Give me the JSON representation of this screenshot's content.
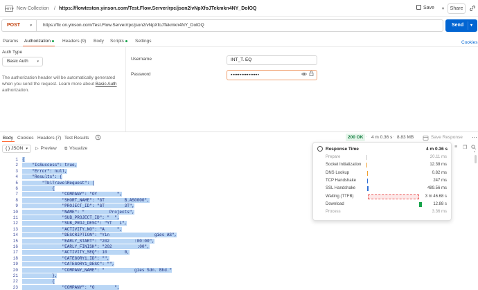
{
  "titlebar": {
    "http_badge": "HTTP",
    "collection": "New Collection",
    "separator": "/",
    "request_url": "https://flowteston.yinson.com/Test.Flow.Server/rpc/json2/vNpXfoJTekmkn4NY_DolOQ",
    "save_label": "Save",
    "save_chevron": "▾",
    "share_label": "Share",
    "link_icon": "link-icon"
  },
  "urlbar": {
    "method": "POST",
    "url": "https://flc                on.yinson.com/Test.Flow.Server/rpc/json2/vNpXfoJTekmkn4NY_DolOQ",
    "send_label": "Send",
    "send_chevron": "▾"
  },
  "request_tabs": {
    "params": "Params",
    "authorization": "Authorization",
    "headers": "Headers (9)",
    "body": "Body",
    "scripts": "Scripts",
    "settings": "Settings",
    "active": "authorization",
    "cookies": "Cookies"
  },
  "auth": {
    "type_label": "Auth Type",
    "type_value": "Basic Auth",
    "type_chevron": "▾",
    "description_text": "The authorization header will be automatically generated when you send the request. Learn more about ",
    "description_link": "Basic Auth",
    "description_end": " authorization.",
    "username_label": "Username",
    "username_value": "INT_T.       EQ",
    "password_label": "Password",
    "password_value": "••••••••••••••••",
    "eye_icon": "eye-icon",
    "lock_icon": "lock-icon"
  },
  "response_tabs": {
    "body": "Body",
    "cookies": "Cookies",
    "headers": "Headers (7)",
    "test_results": "Test Results",
    "history_icon": "history-icon",
    "status": "200 OK",
    "time": "4 m 0.36 s",
    "size": "8.83 MB",
    "save_response": "Save Response",
    "more_icon": "more-icon"
  },
  "body_toolbar": {
    "format": "{ } JSON",
    "format_chevron": "▾",
    "preview": "Preview",
    "visualize": "Visualize",
    "filter_icon": "filter-icon",
    "copy_icon": "copy-icon",
    "search_icon": "search-icon"
  },
  "code_lines": [
    {
      "n": "1",
      "indent": "",
      "text": "{"
    },
    {
      "n": "2",
      "indent": "    ",
      "text": "\"IsSuccess\": true,"
    },
    {
      "n": "3",
      "indent": "    ",
      "text": "\"Error\": null,"
    },
    {
      "n": "4",
      "indent": "    ",
      "text": "\"Results\": {"
    },
    {
      "n": "5",
      "indent": "        ",
      "text": "\"TblTravelRequest\": ["
    },
    {
      "n": "6",
      "indent": "            ",
      "text": "{"
    },
    {
      "n": "7",
      "indent": "                ",
      "text": "\"COMPANY\": \"OY        \","
    },
    {
      "n": "8",
      "indent": "                ",
      "text": "\"SHORT_NAME\": \"GT        B.AS0000\","
    },
    {
      "n": "9",
      "indent": "                ",
      "text": "\"PROJECT_ID\": \"GT        3T\","
    },
    {
      "n": "10",
      "indent": "                ",
      "text": "\"NAME\": \"          Projects\","
    },
    {
      "n": "11",
      "indent": "                ",
      "text": "\"SUB_PROJECT_ID\": \"  \","
    },
    {
      "n": "12",
      "indent": "                ",
      "text": "\"SUB_PROJ_DESC\": \"YT   L\","
    },
    {
      "n": "13",
      "indent": "                ",
      "text": "\"ACTIVITY_NO\": \"A     \","
    },
    {
      "n": "14",
      "indent": "                ",
      "text": "\"DESCRIPTION\": \"Yin                  gies AS\","
    },
    {
      "n": "15",
      "indent": "                ",
      "text": "\"EARLY_START\": \"202          :00:00\","
    },
    {
      "n": "16",
      "indent": "                ",
      "text": "\"EARLY_FINISH\": \"202          :00\","
    },
    {
      "n": "17",
      "indent": "                ",
      "text": "\"ACTIVITY_SEQ\": 10       0,"
    },
    {
      "n": "18",
      "indent": "                ",
      "text": "\"CATEGORY1_ID\": \"\","
    },
    {
      "n": "19",
      "indent": "                ",
      "text": "\"CATEGORY1_DESC\": \"\","
    },
    {
      "n": "20",
      "indent": "                ",
      "text": "\"COMPANY_NAME\": \"            gies Sdn. Bhd.\""
    },
    {
      "n": "21",
      "indent": "            ",
      "text": "},"
    },
    {
      "n": "22",
      "indent": "            ",
      "text": "{"
    },
    {
      "n": "23",
      "indent": "                ",
      "text": "\"COMPANY\": \"O        \","
    }
  ],
  "timing": {
    "title": "Response Time",
    "total": "4 m 0.36 s",
    "clock_icon": "clock-icon",
    "rows": [
      {
        "label": "Prepare",
        "value": "20.11 ms",
        "dim": true,
        "color": "#c8c8c8",
        "start": 0.0,
        "width": 0.004
      },
      {
        "label": "Socket Initialization",
        "value": "12.38 ms",
        "dim": false,
        "color": "#f0a030",
        "start": 0.004,
        "width": 0.004
      },
      {
        "label": "DNS Lookup",
        "value": "0.82 ms",
        "dim": false,
        "color": "#f0a030",
        "start": 0.008,
        "width": 0.004
      },
      {
        "label": "TCP Handshake",
        "value": "247 ms",
        "dim": false,
        "color": "#2f6fd6",
        "start": 0.008,
        "width": 0.01
      },
      {
        "label": "SSL Handshake",
        "value": "489.56 ms",
        "dim": false,
        "color": "#2f6fd6",
        "start": 0.018,
        "width": 0.015
      },
      {
        "label": "Waiting (TTFB)",
        "value": "3 m 46.68 s",
        "dim": false,
        "color": "#e85050",
        "start": 0.03,
        "width": 0.94
      },
      {
        "label": "Download",
        "value": "12.88 s",
        "dim": false,
        "color": "#16a34a",
        "start": 0.975,
        "width": 0.05
      },
      {
        "label": "Process",
        "value": "3.36 ms",
        "dim": true,
        "color": "#c8c8c8",
        "start": 1.0,
        "width": 0.0
      }
    ]
  },
  "colors": {
    "accent": "#ff6c37",
    "send": "#0265d2",
    "status_ok": "#0f7b3c",
    "selection": "#b9d6f5"
  }
}
